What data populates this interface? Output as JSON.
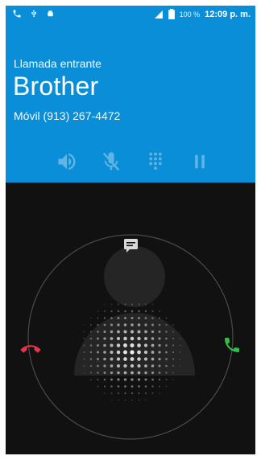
{
  "status_bar": {
    "icons": [
      "phone-call-icon",
      "usb-icon",
      "android-icon",
      "signal-icon",
      "battery-icon"
    ],
    "battery_text": "100 %",
    "time": "12:09 p. m."
  },
  "call": {
    "incoming_label": "Llamada entrante",
    "caller_name": "Brother",
    "caller_number": "Móvil (913) 267-4472"
  },
  "controls": [
    "speaker-icon",
    "mute-icon",
    "dialpad-icon",
    "hold-icon"
  ],
  "answer_widget": {
    "icons": [
      "message-icon",
      "decline-icon",
      "answer-icon"
    ],
    "colors": {
      "decline": "#e8334a",
      "answer": "#2fbf4a",
      "header": "#0b8ed8"
    }
  }
}
